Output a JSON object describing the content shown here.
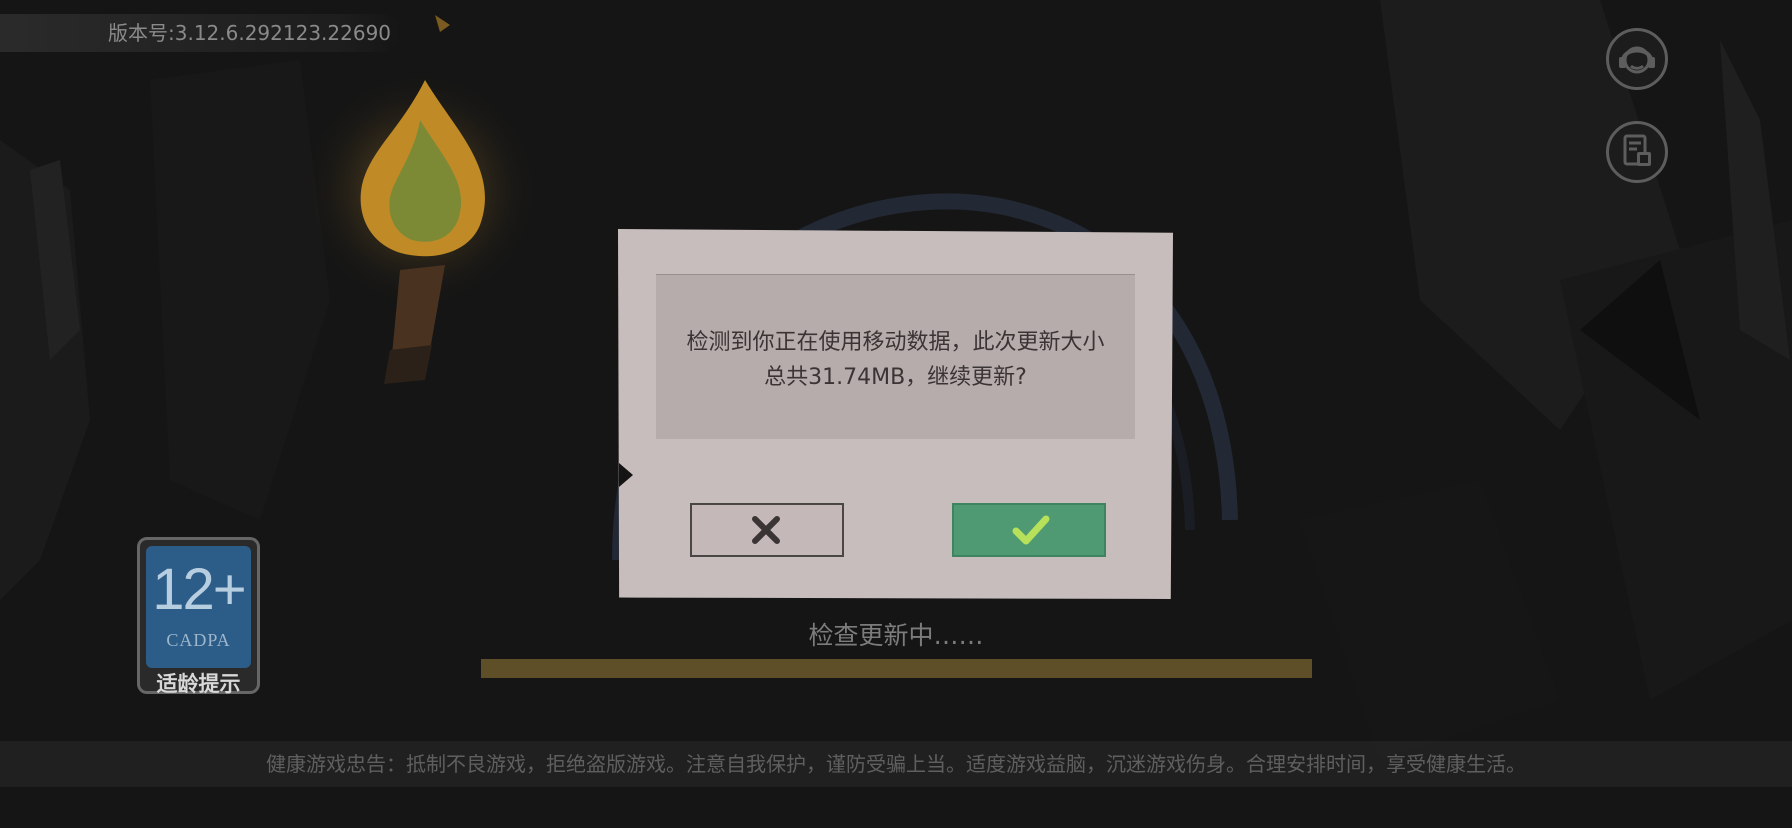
{
  "version": "版本号:3.12.6.292123.22690",
  "hud": {
    "service_icon": "headset-icon",
    "repair_icon": "file-repair-icon"
  },
  "age_rating": {
    "number": "12+",
    "org": "CADPA",
    "label": "适龄提示"
  },
  "dialog": {
    "message_line1": "检测到你正在使用移动数据，此次更新大小",
    "message_line2": "总共31.74MB，继续更新?",
    "cancel_icon": "close-icon",
    "confirm_icon": "checkmark-icon"
  },
  "status_text": "检查更新中……",
  "progress": 1.0,
  "health_notice": "健康游戏忠告：抵制不良游戏，拒绝盗版游戏。注意自我保护，谨防受骗上当。适度游戏益脑，沉迷游戏伤身。合理安排时间，享受健康生活。",
  "colors": {
    "confirm_button": "#4f9a72",
    "dialog_bg": "#c7bdbc",
    "progress": "#5e4f28"
  }
}
